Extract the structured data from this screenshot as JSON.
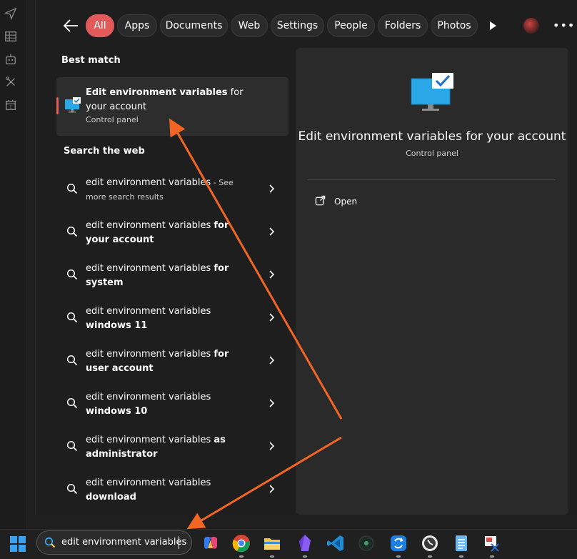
{
  "filters": [
    "All",
    "Apps",
    "Documents",
    "Web",
    "Settings",
    "People",
    "Folders",
    "Photos"
  ],
  "best_match": {
    "heading": "Best match",
    "title_bold": "Edit environment variables",
    "title_rest": " for your account",
    "subtitle": "Control panel"
  },
  "web": {
    "heading": "Search the web",
    "items": [
      {
        "prefix": "edit environment variables",
        "bold": "",
        "suffix": " - See",
        "sub": "more search results"
      },
      {
        "prefix": "edit environment variables ",
        "bold": "for your account",
        "suffix": "",
        "sub": ""
      },
      {
        "prefix": "edit environment variables ",
        "bold": "for system",
        "suffix": "",
        "sub": ""
      },
      {
        "prefix": "edit environment variables ",
        "bold": "windows 11",
        "suffix": "",
        "sub": ""
      },
      {
        "prefix": "edit environment variables ",
        "bold": "for user account",
        "suffix": "",
        "sub": ""
      },
      {
        "prefix": "edit environment variables ",
        "bold": "windows 10",
        "suffix": "",
        "sub": ""
      },
      {
        "prefix": "edit environment variables ",
        "bold": "as administrator",
        "suffix": "",
        "sub": ""
      },
      {
        "prefix": "edit environment variables ",
        "bold": "download",
        "suffix": "",
        "sub": ""
      }
    ]
  },
  "detail": {
    "title": "Edit environment variables for your account",
    "subtitle": "Control panel",
    "open_label": "Open"
  },
  "taskbar": {
    "search_query": "edit environment variables",
    "apps": [
      "copilot-icon",
      "chrome-icon",
      "file-explorer-icon",
      "obsidian-icon",
      "vscode-icon",
      "circle-app-icon",
      "sync-app-icon",
      "clock-app-icon",
      "notepad-icon",
      "snipping-tool-icon"
    ]
  },
  "colors": {
    "accent": "#e25a5a",
    "arrow": "#f26522",
    "panel": "#2a2a2a"
  }
}
